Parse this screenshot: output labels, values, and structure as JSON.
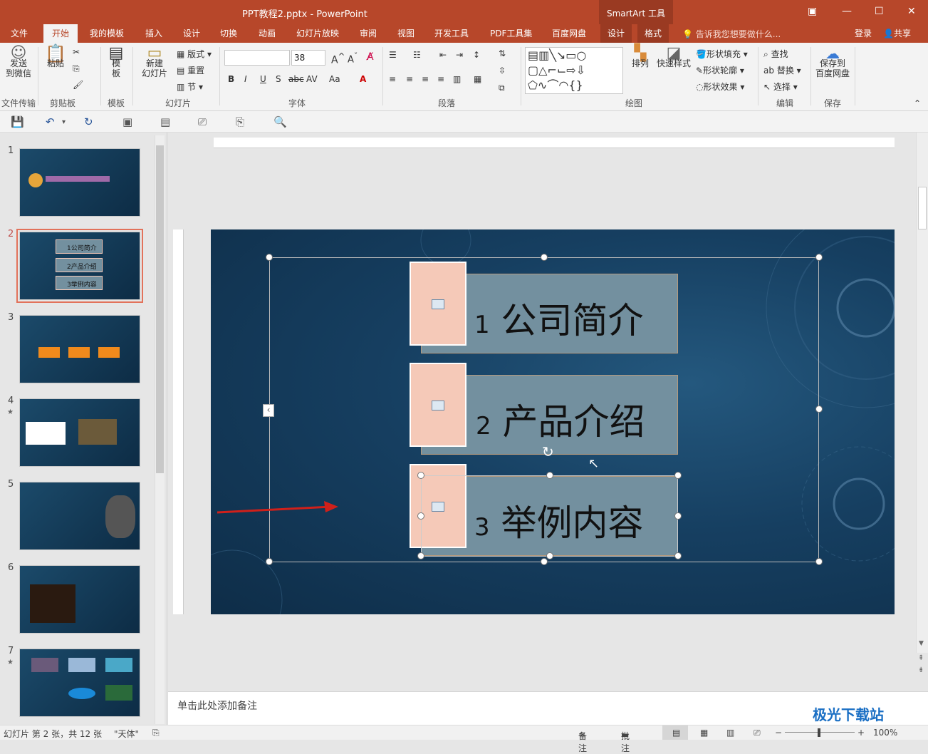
{
  "window": {
    "title": "PPT教程2.pptx - PowerPoint",
    "context_tools": "SmartArt 工具"
  },
  "tabs": [
    "文件",
    "开始",
    "我的模板",
    "插入",
    "设计",
    "切换",
    "动画",
    "幻灯片放映",
    "审阅",
    "视图",
    "开发工具",
    "PDF工具集",
    "百度网盘"
  ],
  "context_tabs": [
    "设计",
    "格式"
  ],
  "tell_me": "告诉我您想要做什么...",
  "account": {
    "login": "登录",
    "share": "共享"
  },
  "ribbon": {
    "send_wechat": "发送\n到微信",
    "paste": "粘贴",
    "template": "模\n板",
    "new_slide": "新建\n幻灯片",
    "layout": "版式",
    "reset": "重置",
    "section": "节",
    "font_size": "38",
    "arrange": "排列",
    "quick_styles": "快速样式",
    "shape_fill": "形状填充",
    "shape_outline": "形状轮廓",
    "shape_effects": "形状效果",
    "find": "查找",
    "replace": "替换",
    "select": "选择",
    "save_baidu": "保存到\n百度网盘",
    "groups": [
      "文件传输",
      "剪贴板",
      "模板",
      "幻灯片",
      "字体",
      "段落",
      "绘图",
      "编辑",
      "保存"
    ]
  },
  "thumbnails": [
    {
      "num": "1",
      "star": ""
    },
    {
      "num": "2",
      "star": "",
      "selected": true,
      "items": [
        "1公司简介",
        "2产品介绍",
        "3举例内容"
      ]
    },
    {
      "num": "3",
      "star": ""
    },
    {
      "num": "4",
      "star": "★"
    },
    {
      "num": "5",
      "star": ""
    },
    {
      "num": "6",
      "star": ""
    },
    {
      "num": "7",
      "star": "★"
    }
  ],
  "slide": {
    "items": [
      {
        "num": "1",
        "text": "公司简介"
      },
      {
        "num": "2",
        "text": "产品介绍"
      },
      {
        "num": "3",
        "text": "举例内容"
      }
    ]
  },
  "notes_placeholder": "单击此处添加备注",
  "status": {
    "slide_info": "幻灯片 第 2 张，共 12 张",
    "theme": "\"天体\"",
    "notes": "备注",
    "comments": "批注",
    "zoom": "100%"
  },
  "watermark": "极光下载站"
}
